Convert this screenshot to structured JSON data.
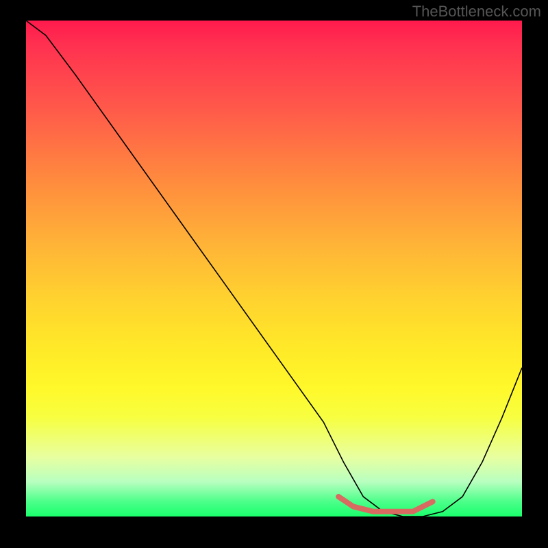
{
  "watermark": "TheBottleneck.com",
  "chart_data": {
    "type": "line",
    "title": "",
    "xlabel": "",
    "ylabel": "",
    "xlim": [
      0,
      100
    ],
    "ylim": [
      0,
      100
    ],
    "series": [
      {
        "name": "curve",
        "x": [
          0,
          4,
          10,
          20,
          30,
          40,
          50,
          60,
          64,
          68,
          72,
          76,
          80,
          84,
          88,
          92,
          96,
          100
        ],
        "values": [
          100,
          97,
          89,
          75,
          61,
          47,
          33,
          19,
          11,
          4,
          1,
          0,
          0,
          1,
          4,
          11,
          20,
          30
        ]
      }
    ],
    "highlight": {
      "name": "bottom-highlight",
      "color": "#d86a62",
      "x": [
        63,
        66,
        70,
        74,
        78,
        82
      ],
      "values": [
        4,
        2,
        1,
        1,
        1,
        3
      ]
    },
    "gradient_stops": [
      {
        "pos": 0,
        "color": "#ff1a4d"
      },
      {
        "pos": 18,
        "color": "#ff5a4a"
      },
      {
        "pos": 44,
        "color": "#ffb038"
      },
      {
        "pos": 66,
        "color": "#ffe928"
      },
      {
        "pos": 88,
        "color": "#e8ffa0"
      },
      {
        "pos": 100,
        "color": "#1aff6c"
      }
    ]
  }
}
